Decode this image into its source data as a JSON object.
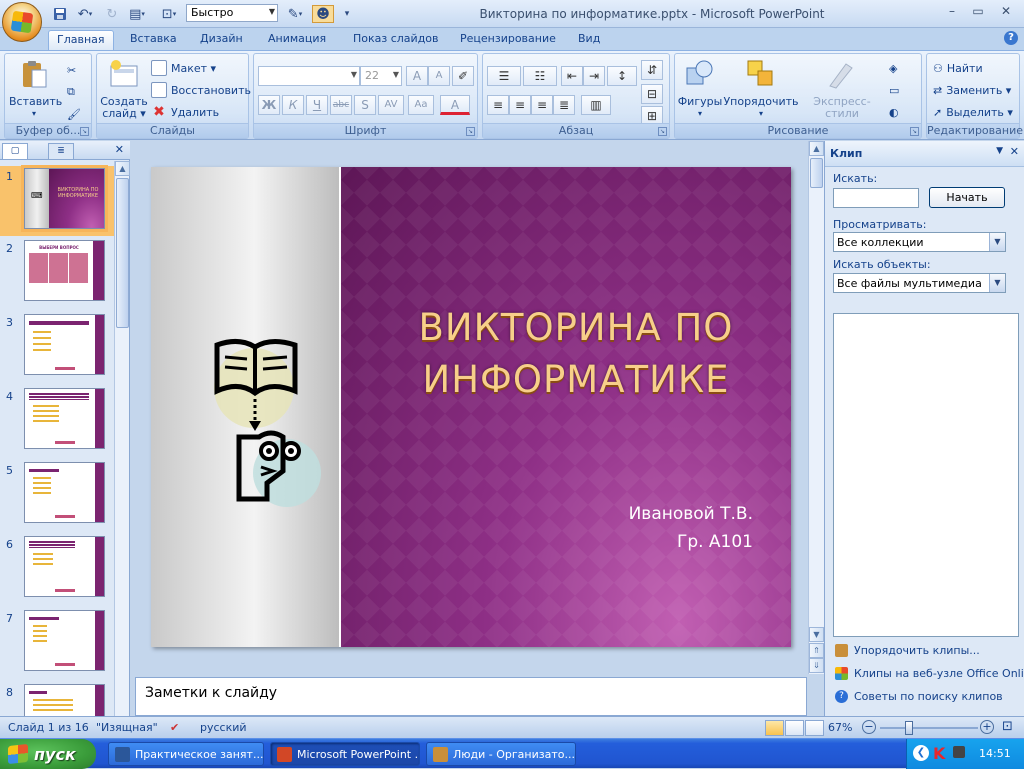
{
  "app": {
    "title": "Викторина по информатике.pptx - Microsoft PowerPoint",
    "qat_combo_value": "Быстро",
    "window_controls": [
      "–",
      "▭",
      "✕"
    ]
  },
  "tabs": [
    "Главная",
    "Вставка",
    "Дизайн",
    "Анимация",
    "Показ слайдов",
    "Рецензирование",
    "Вид"
  ],
  "active_tab": "Главная",
  "ribbon": {
    "clipboard": {
      "label": "Буфер об...",
      "paste": "Вставить"
    },
    "slides": {
      "label": "Слайды",
      "new_slide_line1": "Создать",
      "new_slide_line2": "слайд ▾",
      "layout": "Макет ▾",
      "reset": "Восстановить",
      "delete": "Удалить"
    },
    "font": {
      "label": "Шрифт",
      "font_name_value": "",
      "font_size_value": "22",
      "bold": "Ж",
      "italic": "К",
      "underline": "Ч",
      "strike": "abc",
      "shadow": "S",
      "spacing": "AV",
      "case": "Aa",
      "color": "A",
      "grow": "A",
      "shrink": "A"
    },
    "paragraph": {
      "label": "Абзац"
    },
    "drawing": {
      "label": "Рисование",
      "shapes": "Фигуры",
      "arrange": "Упорядочить",
      "quick_styles": "Экспресс-стили"
    },
    "editing": {
      "label": "Редактирование",
      "find": "Найти",
      "replace": "Заменить ▾",
      "select": "Выделить ▾"
    }
  },
  "thumbnails": {
    "numbers": [
      "1",
      "2",
      "3",
      "4",
      "5",
      "6",
      "7",
      "8"
    ],
    "selected": "1",
    "thumb1_title": "ВИКТОРИНА ПО ИНФОРМАТИКЕ",
    "thumb2_title": "ВЫБЕРИ ВОПРОС"
  },
  "slide": {
    "title_line1": "ВИКТОРИНА ПО",
    "title_line2": "ИНФОРМАТИКЕ",
    "author_line1": "Ивановой Т.В.",
    "author_line2": "Гр. А101"
  },
  "notes_placeholder": "Заметки к слайду",
  "task_pane": {
    "title": "Клип",
    "search_label": "Искать:",
    "search_value": "",
    "go_button": "Начать",
    "browse_label": "Просматривать:",
    "browse_value": "Все коллекции",
    "objects_label": "Искать объекты:",
    "objects_value": "Все файлы мультимедиа",
    "links": [
      "Упорядочить клипы...",
      "Клипы на веб-узле Office Online",
      "Советы по поиску клипов"
    ]
  },
  "status": {
    "slide_info": "Слайд 1 из 16",
    "theme": "\"Изящная\"",
    "language": "русский",
    "zoom": "67%",
    "zoom_level": 0.3
  },
  "taskbar": {
    "start": "пуск",
    "tasks": [
      "Практическое занят...",
      "Microsoft PowerPoint ...",
      "Люди - Организато..."
    ],
    "active_task": "Microsoft PowerPoint ...",
    "lang": "RU",
    "clock": "14:51"
  },
  "colors": {
    "accent": "#15428b",
    "slide_purple": "#8e2f86",
    "title_gold": "#f7cf8a",
    "taskbar_blue": "#245edb",
    "start_green": "#3a9c3a"
  }
}
